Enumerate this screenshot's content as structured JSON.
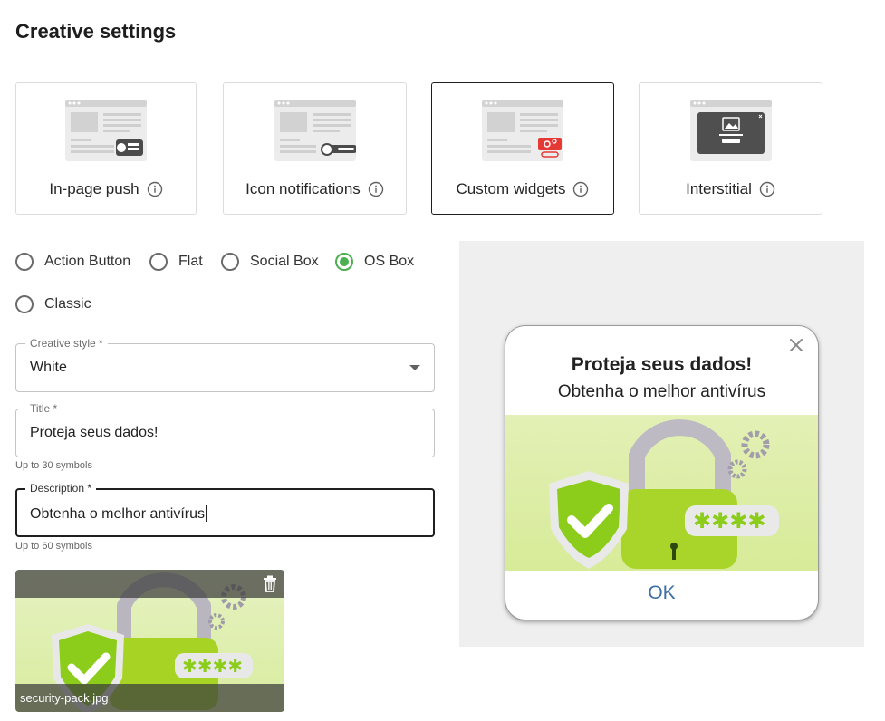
{
  "page": {
    "title": "Creative settings"
  },
  "formats": [
    {
      "label": "In-page push",
      "selected": false,
      "icon": "in-page-push-illustration"
    },
    {
      "label": "Icon notifications",
      "selected": false,
      "icon": "icon-notifications-illustration"
    },
    {
      "label": "Custom widgets",
      "selected": true,
      "icon": "custom-widgets-illustration"
    },
    {
      "label": "Interstitial",
      "selected": false,
      "icon": "interstitial-illustration"
    }
  ],
  "widget_types": [
    {
      "label": "Action Button",
      "checked": false
    },
    {
      "label": "Flat",
      "checked": false
    },
    {
      "label": "Social Box",
      "checked": false
    },
    {
      "label": "OS Box",
      "checked": true
    },
    {
      "label": "Classic",
      "checked": false
    }
  ],
  "fields": {
    "creative_style": {
      "label": "Creative style *",
      "value": "White"
    },
    "title": {
      "label": "Title *",
      "value": "Proteja seus dados!",
      "helper": "Up to 30 symbols"
    },
    "description": {
      "label": "Description *",
      "value": "Obtenha o melhor antivírus",
      "helper": "Up to 60 symbols"
    }
  },
  "upload": {
    "filename": "security-pack.jpg"
  },
  "preview": {
    "title": "Proteja seus dados!",
    "description": "Obtenha o melhor antivírus",
    "button": "OK"
  },
  "colors": {
    "accent_green": "#4caf50",
    "ok_blue": "#3f6fa5",
    "preview_bg": "#efefef"
  }
}
